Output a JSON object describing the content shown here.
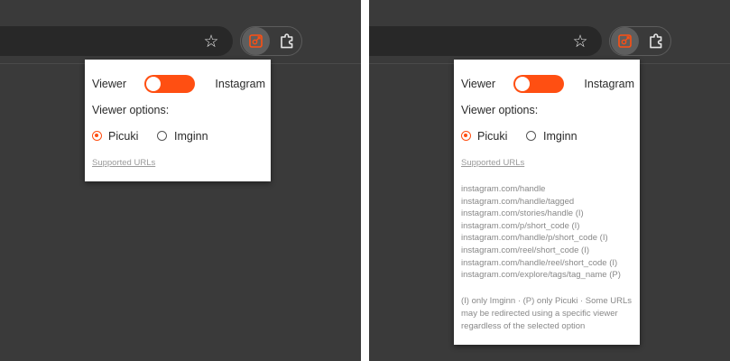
{
  "toolbar": {
    "bookmark_icon": "star-icon",
    "extension_icon": "viewer-extension-logo-icon",
    "extensions_menu_icon": "puzzle-icon",
    "accent_color": "#ff4f12"
  },
  "popup": {
    "viewer_label": "Viewer",
    "instagram_label": "Instagram",
    "toggle_state": "viewer",
    "options_heading": "Viewer options:",
    "options": [
      {
        "label": "Picuki",
        "selected": true
      },
      {
        "label": "Imginn",
        "selected": false
      }
    ],
    "supported_urls_link": "Supported URLs",
    "urls": [
      "instagram.com/handle",
      "instagram.com/handle/tagged",
      "instagram.com/stories/handle (I)",
      "instagram.com/p/short_code (I)",
      "instagram.com/handle/p/short_code (I)",
      "instagram.com/reel/short_code (I)",
      "instagram.com/handle/reel/short_code (I)",
      "instagram.com/explore/tags/tag_name (P)"
    ],
    "notes": "(I) only Imginn · (P) only Picuki · Some URLs may be redirected using a specific viewer regardless of the selected option"
  }
}
